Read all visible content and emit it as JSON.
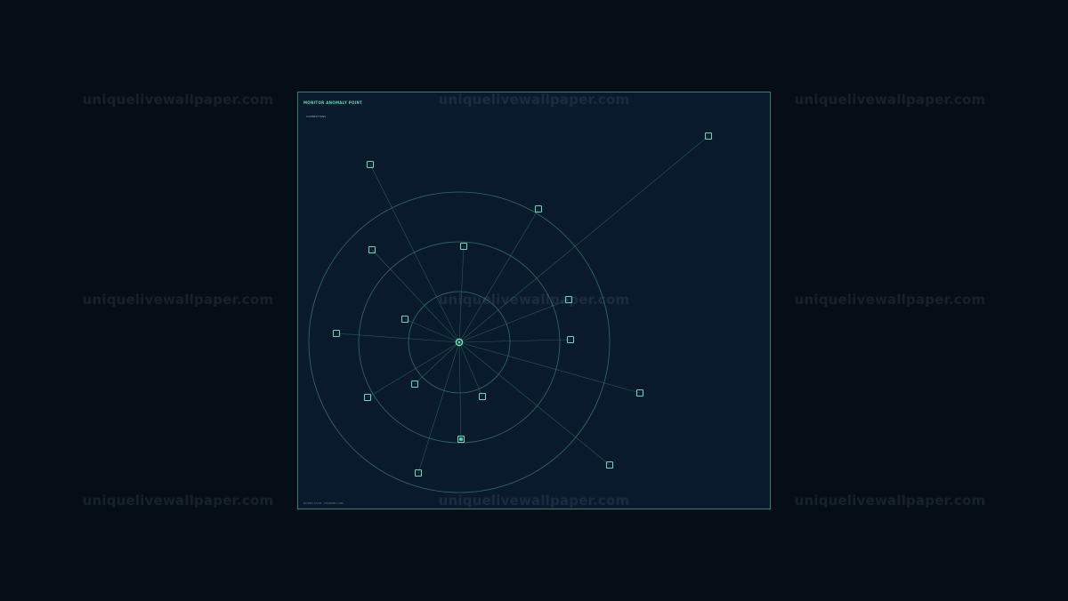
{
  "panel": {
    "title": "MONITOR ANOMALY POINT",
    "subtitle": "CONNECTIONS",
    "footer": "NODES SCAN · CHANNEL LINK"
  },
  "watermarks": [
    "uniquelivewallpaper.com",
    "uniquelivewallpaper.com",
    "uniquelivewallpaper.com",
    "uniquelivewallpaper.com",
    "uniquelivewallpaper.com",
    "uniquelivewallpaper.com",
    "uniquelivewallpaper.com",
    "uniquelivewallpaper.com",
    "uniquelivewallpaper.com"
  ],
  "network": {
    "ring_count": 3,
    "node_count": 17,
    "highlighted_node_count": 1,
    "colors": {
      "background": "#050d17",
      "panel": "#0a1a2d",
      "panel_border": "#3f7a6f",
      "accent": "#68d9b5",
      "link": "#2d6b5d",
      "watermark": "#31475d"
    },
    "icons": {
      "center": "center-node-icon",
      "node": "node-bracket-icon",
      "highlighted": "active-node-icon"
    }
  }
}
